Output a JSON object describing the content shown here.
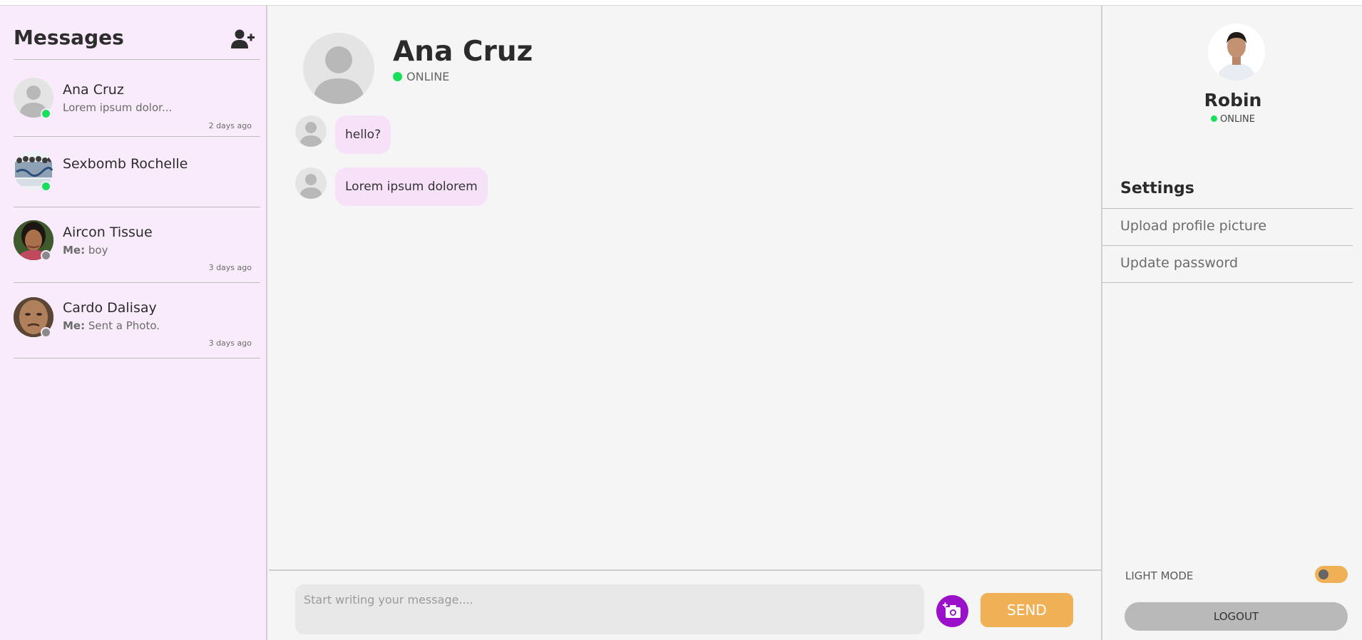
{
  "colors": {
    "sidebar_bg": "#f9ebfb",
    "bubble_bg": "#f6e1f9",
    "online": "#18e05c",
    "offline": "#8a8a8a",
    "accent_orange": "#efb056",
    "camera_purple": "#9b11c9"
  },
  "sidebar": {
    "title": "Messages",
    "add_icon": "add-user-icon",
    "conversations": [
      {
        "name": "Ana Cruz",
        "preview_prefix": "",
        "preview": "Lorem ipsum dolor...",
        "time": "2 days ago",
        "status": "online"
      },
      {
        "name": "Sexbomb Rochelle",
        "preview_prefix": "",
        "preview": "",
        "time": "",
        "status": "online"
      },
      {
        "name": "Aircon Tissue",
        "preview_prefix": "Me:",
        "preview": "boy",
        "time": "3 days ago",
        "status": "offline"
      },
      {
        "name": "Cardo Dalisay",
        "preview_prefix": "Me:",
        "preview": "Sent a Photo.",
        "time": "3 days ago",
        "status": "offline"
      }
    ]
  },
  "chat": {
    "contact_name": "Ana Cruz",
    "contact_status": "ONLINE",
    "messages": [
      {
        "text": "hello?"
      },
      {
        "text": "Lorem ipsum dolorem"
      }
    ],
    "input_placeholder": "Start writing your message....",
    "camera_icon": "camera-add-icon",
    "send_label": "SEND"
  },
  "profile": {
    "name": "Robin",
    "status": "ONLINE",
    "settings_title": "Settings",
    "settings_items": [
      "Upload profile picture",
      "Update password"
    ],
    "mode_label": "LIGHT MODE",
    "logout_label": "LOGOUT"
  }
}
